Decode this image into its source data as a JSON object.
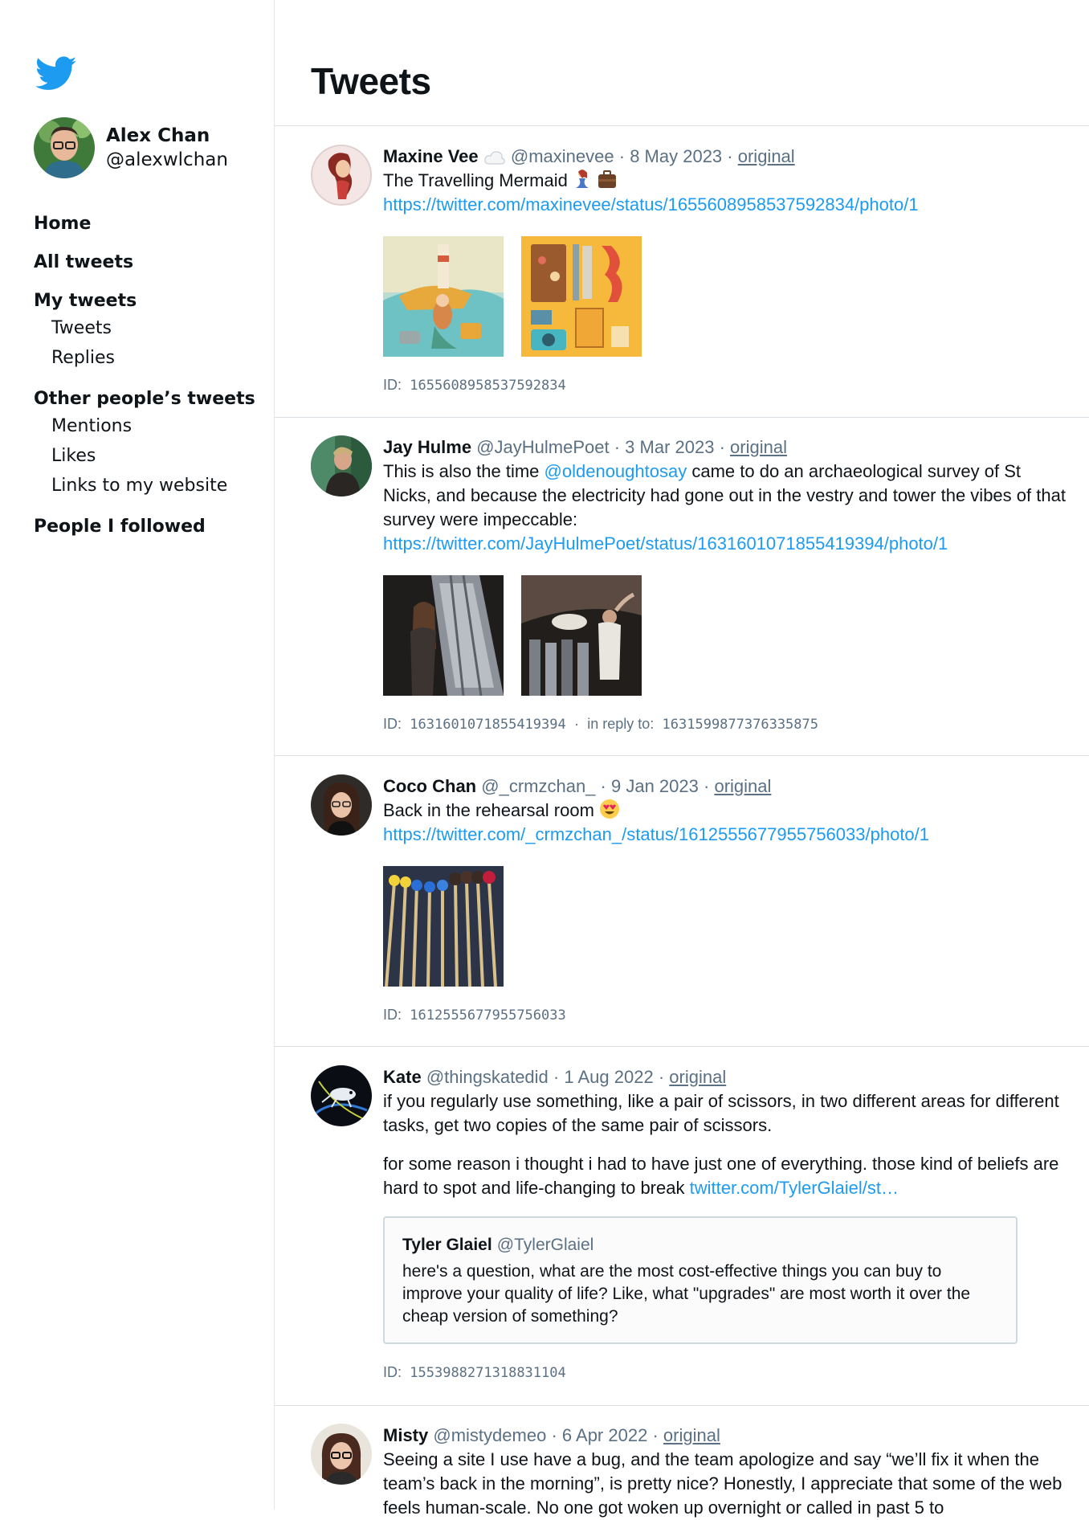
{
  "sidebar": {
    "user": {
      "name": "Alex Chan",
      "handle": "@alexwlchan"
    },
    "nav": {
      "home": "Home",
      "all_tweets": "All tweets",
      "my_tweets": "My tweets",
      "my_tweets_sub": [
        "Tweets",
        "Replies"
      ],
      "other_tweets": "Other people’s tweets",
      "other_sub": [
        "Mentions",
        "Likes",
        "Links to my website"
      ],
      "people_followed": "People I followed"
    }
  },
  "main": {
    "title": "Tweets",
    "original_label": "original",
    "id_label": "ID:",
    "reply_label": "in reply to:",
    "tweets": [
      {
        "name": "Maxine Vee",
        "handle": "@maxinevee",
        "date": "8 May 2023",
        "text": "The Travelling Mermaid",
        "link": "https://twitter.com/maxinevee/status/1655608958537592834/photo/1",
        "id": "1655608958537592834"
      },
      {
        "name": "Jay Hulme",
        "handle": "@JayHulmePoet",
        "date": "3 Mar 2023",
        "text_before": "This is also the time",
        "mention": "@oldenoughtosay",
        "text_after": "came to do an archaeological survey of St Nicks, and because the electricity had gone out in the vestry and tower the vibes of that survey were impeccable:",
        "link": "https://twitter.com/JayHulmePoet/status/1631601071855419394/photo/1",
        "id": "1631601071855419394",
        "reply_to": "1631599877376335875"
      },
      {
        "name": "Coco Chan",
        "handle": "@_crmzchan_",
        "date": "9 Jan 2023",
        "text": "Back in the rehearsal room",
        "link": "https://twitter.com/_crmzchan_/status/1612555677955756033/photo/1",
        "id": "1612555677955756033"
      },
      {
        "name": "Kate",
        "handle": "@thingskatedid",
        "date": "1 Aug 2022",
        "text_p1": "if you regularly use something, like a pair of scissors, in two different areas for different tasks, get two copies of the same pair of scissors.",
        "text_p2": "for some reason i thought i had to have just one of everything. those kind of beliefs are hard to spot and life-changing to break",
        "link": "twitter.com/TylerGlaiel/st…",
        "quote": {
          "name": "Tyler Glaiel",
          "handle": "@TylerGlaiel",
          "text": "here's a question, what are the most cost-effective things you can buy to improve your quality of life? Like, what \"upgrades\" are most worth it over the cheap version of something?"
        },
        "id": "1553988271318831104"
      },
      {
        "name": "Misty",
        "handle": "@mistydemeo",
        "date": "6 Apr 2022",
        "text": "Seeing a site I use have a bug, and the team apologize and say “we’ll fix it when the team’s back in the morning”, is pretty nice? Honestly, I appreciate that some of the web feels human-scale. No one got woken up overnight or called in past 5 to"
      }
    ]
  },
  "colors": {
    "link": "#1d9bf0",
    "muted": "#5b7083",
    "text": "#0f1419",
    "border": "#d9dee3"
  }
}
